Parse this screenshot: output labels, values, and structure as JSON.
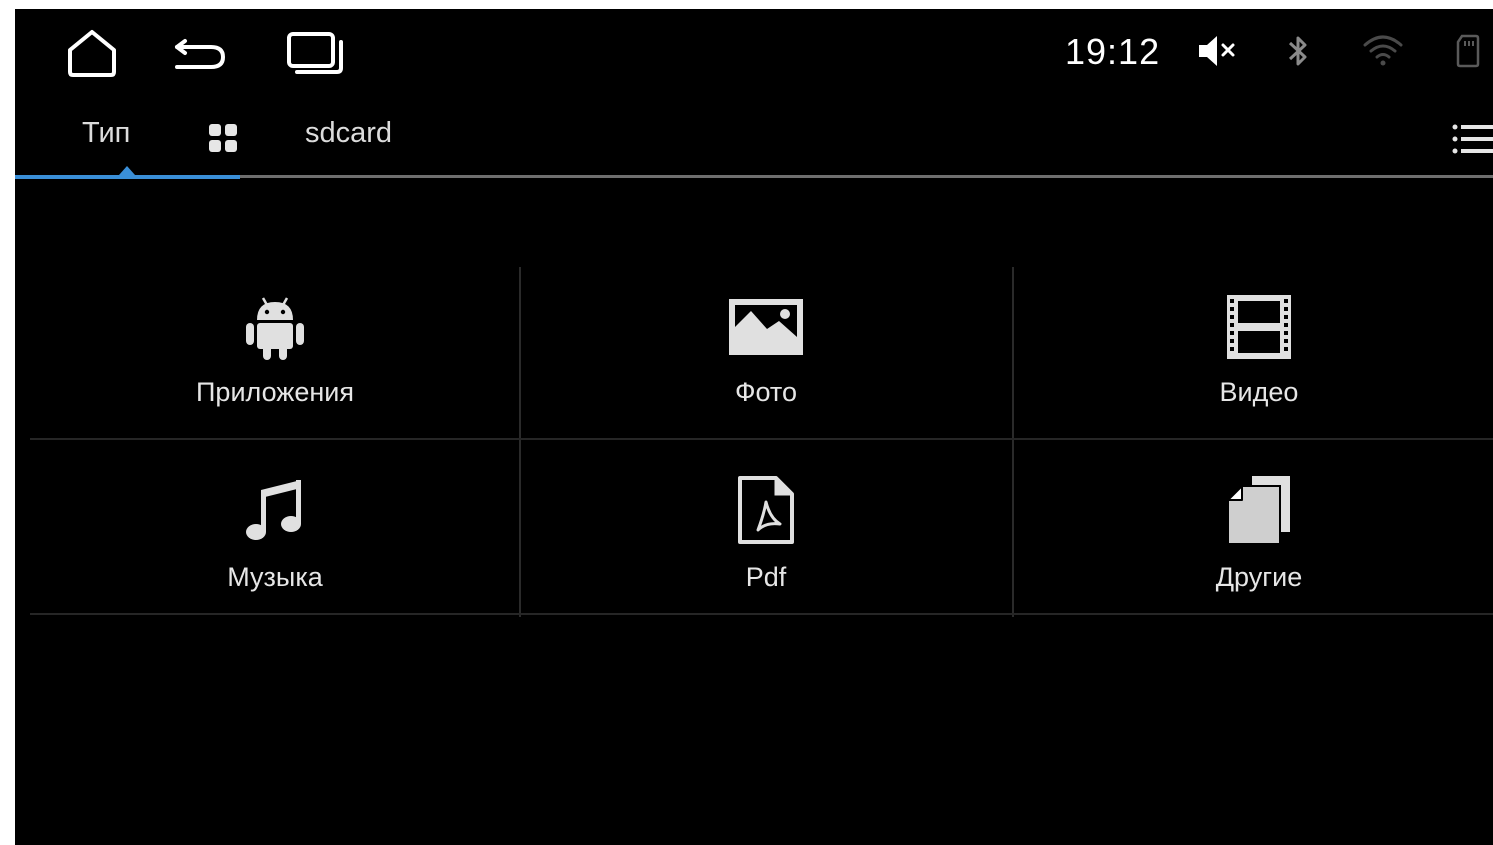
{
  "status_bar": {
    "time": "19:12",
    "nav": [
      "home-icon",
      "back-icon",
      "recent-apps-icon"
    ],
    "indicators": [
      "volume-muted-icon",
      "bluetooth-icon",
      "wifi-icon",
      "sd-card-icon"
    ]
  },
  "tabs": {
    "items": [
      {
        "label": "Тип",
        "active": true
      },
      {
        "label": "",
        "icon": "grid-view-icon"
      },
      {
        "label": "sdcard"
      }
    ],
    "menu_icon": "list-menu-icon",
    "accent_color": "#3a8fd8"
  },
  "categories": [
    {
      "label": "Приложения",
      "icon": "android-icon"
    },
    {
      "label": "Фото",
      "icon": "image-icon"
    },
    {
      "label": "Видео",
      "icon": "film-icon"
    },
    {
      "label": "Музыка",
      "icon": "music-note-icon"
    },
    {
      "label": "Pdf",
      "icon": "pdf-file-icon"
    },
    {
      "label": "Другие",
      "icon": "documents-icon"
    }
  ]
}
